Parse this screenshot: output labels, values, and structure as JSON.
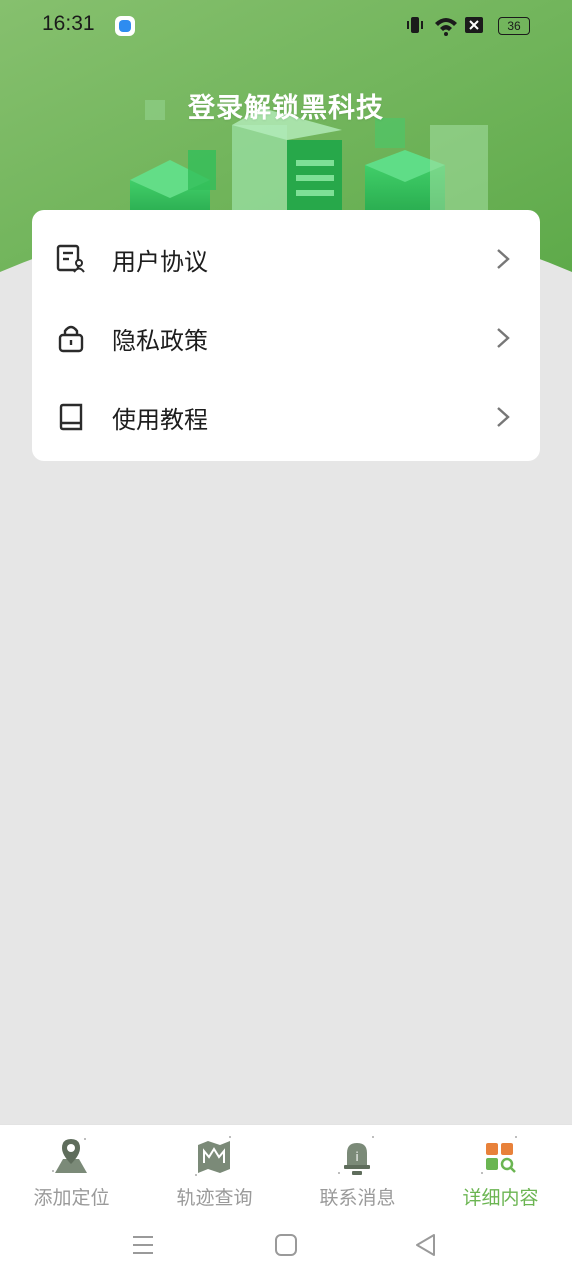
{
  "status": {
    "time": "16:31",
    "battery": "36"
  },
  "header": {
    "title": "登录解锁黑科技"
  },
  "menu": {
    "items": [
      {
        "label": "用户协议",
        "icon": "document-user-icon"
      },
      {
        "label": "隐私政策",
        "icon": "lock-icon"
      },
      {
        "label": "使用教程",
        "icon": "book-icon"
      }
    ]
  },
  "tabs": [
    {
      "label": "添加定位",
      "icon": "location-pin-icon",
      "active": false
    },
    {
      "label": "轨迹查询",
      "icon": "map-icon",
      "active": false
    },
    {
      "label": "联系消息",
      "icon": "bell-icon",
      "active": false
    },
    {
      "label": "详细内容",
      "icon": "grid-search-icon",
      "active": true
    }
  ],
  "colors": {
    "accent": "#6bb552",
    "hero": "#6db35a",
    "background": "#e6e6e6"
  }
}
